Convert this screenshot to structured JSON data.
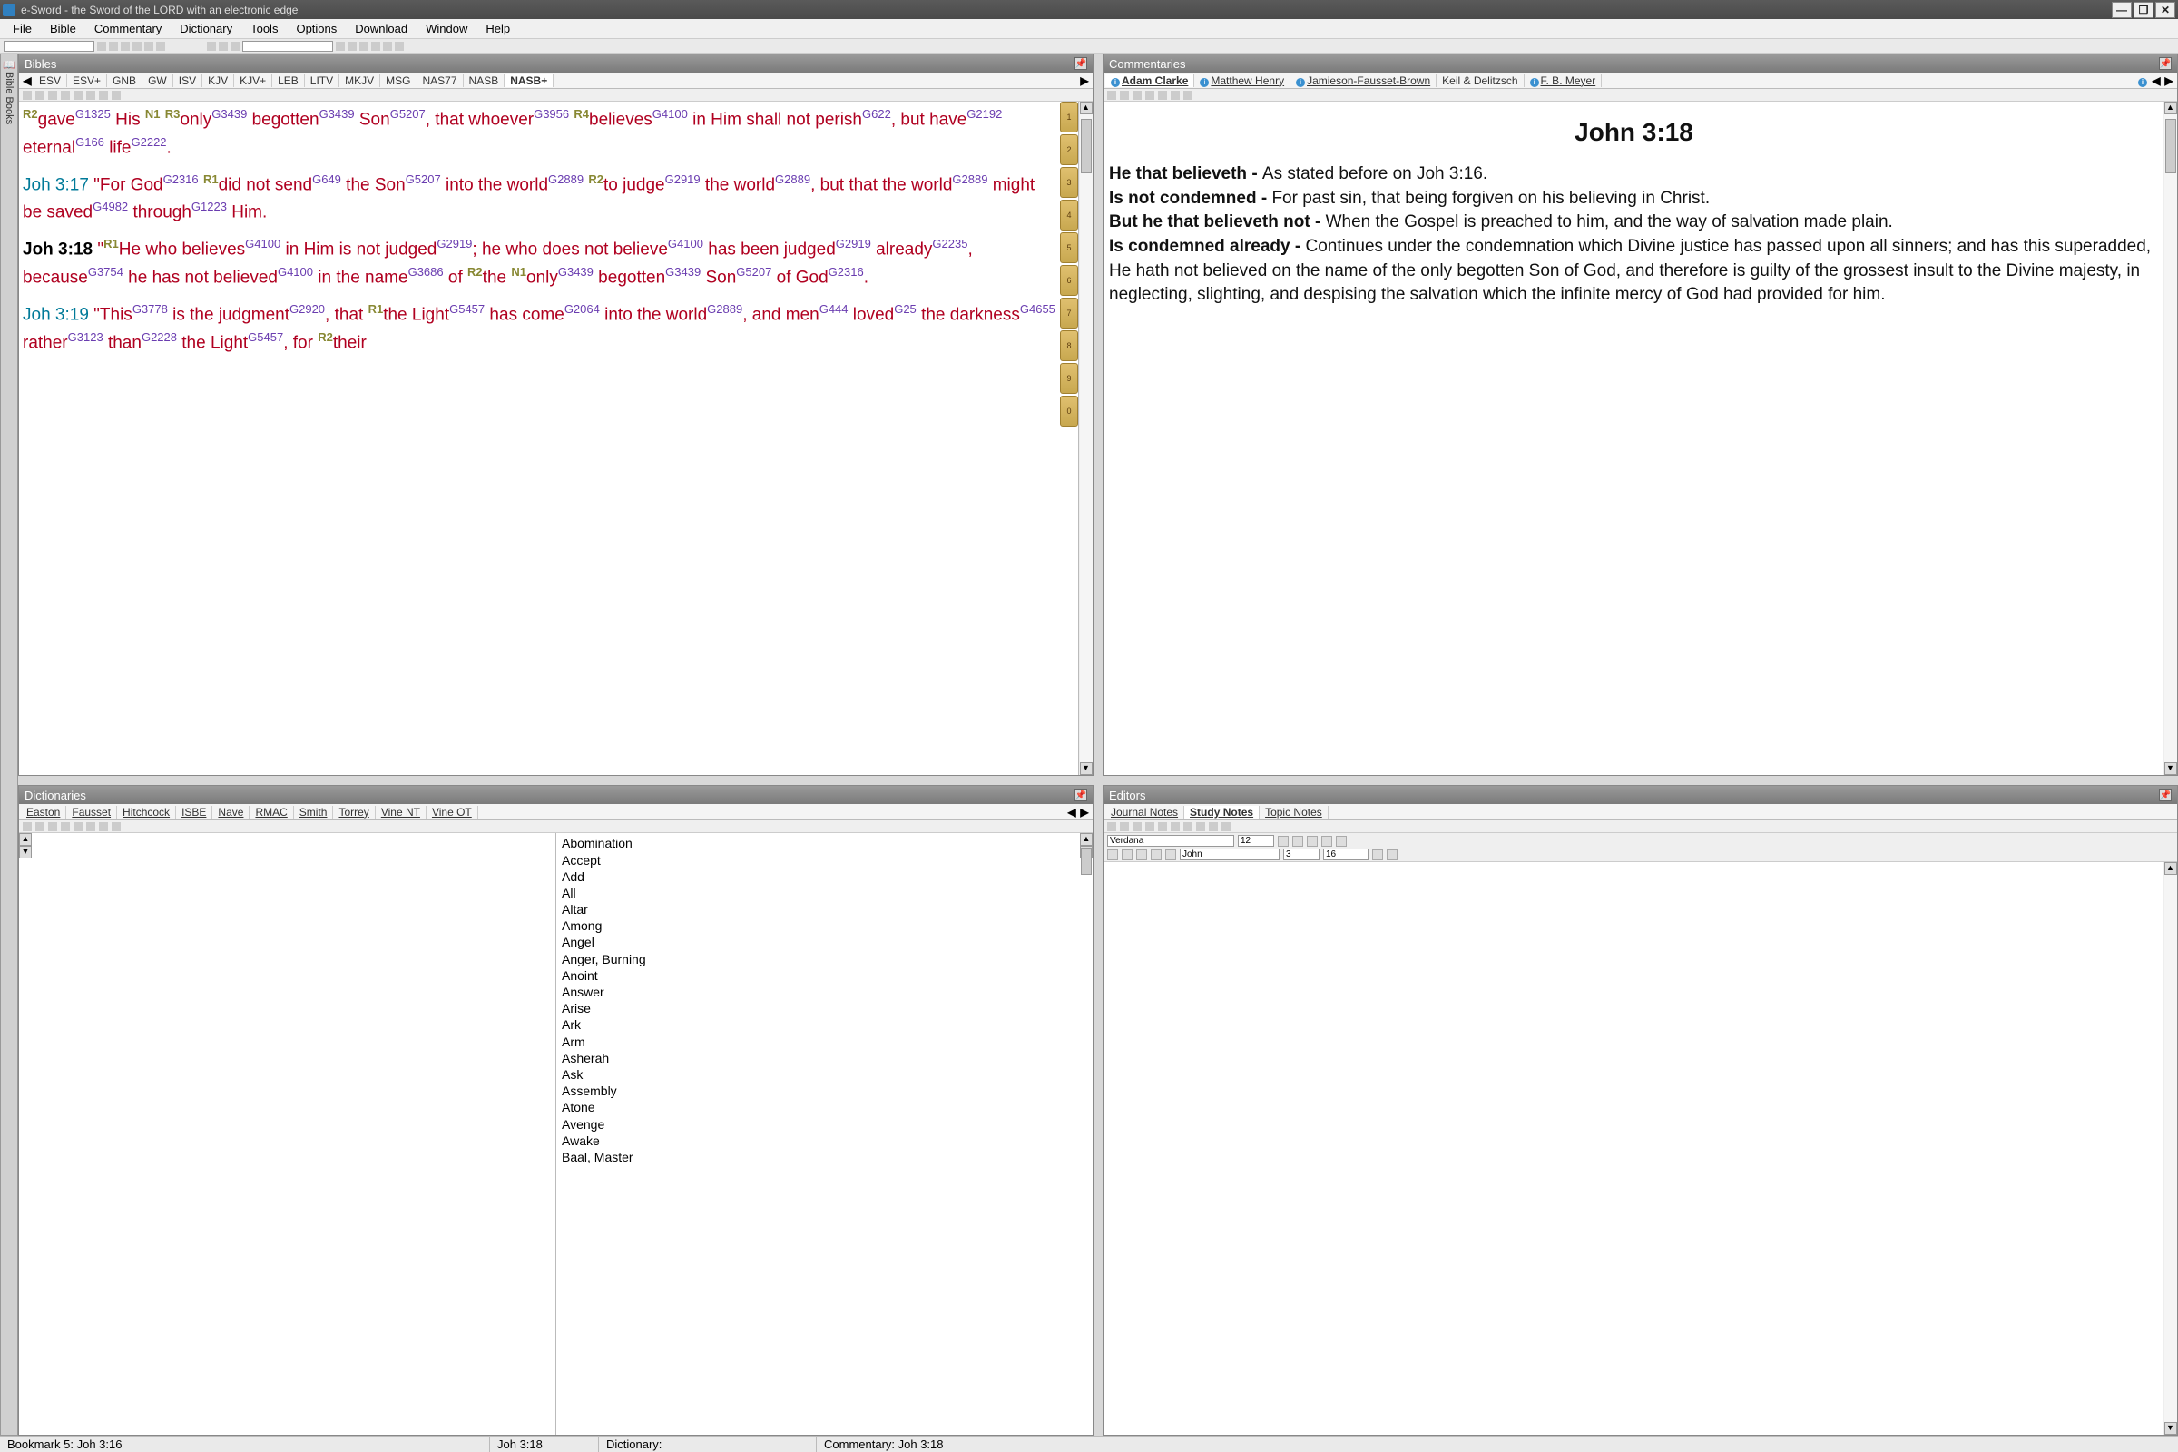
{
  "titlebar": {
    "text": "e-Sword - the Sword of the LORD with an electronic edge"
  },
  "menubar": [
    "File",
    "Bible",
    "Commentary",
    "Dictionary",
    "Tools",
    "Options",
    "Download",
    "Window",
    "Help"
  ],
  "panes": {
    "bibles": {
      "title": "Bibles",
      "tabs": [
        "ESV",
        "ESV+",
        "GNB",
        "GW",
        "ISV",
        "KJV",
        "KJV+",
        "LEB",
        "LITV",
        "MKJV",
        "MSG",
        "NAS77",
        "NASB",
        "NASB+"
      ],
      "verses": [
        {
          "ref": "",
          "segments": [
            {
              "t": "note",
              "v": "R2"
            },
            {
              "t": "w",
              "v": "gave"
            },
            {
              "t": "s",
              "v": "G1325"
            },
            {
              "t": "w",
              "v": " His "
            },
            {
              "t": "note",
              "v": "N1"
            },
            {
              "t": "w",
              "v": " "
            },
            {
              "t": "note",
              "v": "R3"
            },
            {
              "t": "w",
              "v": "only"
            },
            {
              "t": "s",
              "v": "G3439"
            },
            {
              "t": "w",
              "v": " begotten"
            },
            {
              "t": "s",
              "v": "G3439"
            },
            {
              "t": "w",
              "v": " Son"
            },
            {
              "t": "s",
              "v": "G5207"
            },
            {
              "t": "w",
              "v": ", that whoever"
            },
            {
              "t": "s",
              "v": "G3956"
            },
            {
              "t": "w",
              "v": " "
            },
            {
              "t": "note",
              "v": "R4"
            },
            {
              "t": "w",
              "v": "believes"
            },
            {
              "t": "s",
              "v": "G4100"
            },
            {
              "t": "w",
              "v": " in Him shall not perish"
            },
            {
              "t": "s",
              "v": "G622"
            },
            {
              "t": "w",
              "v": ", but have"
            },
            {
              "t": "s",
              "v": "G2192"
            },
            {
              "t": "w",
              "v": " eternal"
            },
            {
              "t": "s",
              "v": "G166"
            },
            {
              "t": "w",
              "v": " life"
            },
            {
              "t": "s",
              "v": "G2222"
            },
            {
              "t": "w",
              "v": "."
            }
          ]
        },
        {
          "ref": "Joh 3:17",
          "segments": [
            {
              "t": "w",
              "v": "\"For God"
            },
            {
              "t": "s",
              "v": "G2316"
            },
            {
              "t": "w",
              "v": " "
            },
            {
              "t": "note",
              "v": "R1"
            },
            {
              "t": "w",
              "v": "did not send"
            },
            {
              "t": "s",
              "v": "G649"
            },
            {
              "t": "w",
              "v": " the Son"
            },
            {
              "t": "s",
              "v": "G5207"
            },
            {
              "t": "w",
              "v": " into the world"
            },
            {
              "t": "s",
              "v": "G2889"
            },
            {
              "t": "w",
              "v": " "
            },
            {
              "t": "note",
              "v": "R2"
            },
            {
              "t": "w",
              "v": "to judge"
            },
            {
              "t": "s",
              "v": "G2919"
            },
            {
              "t": "w",
              "v": " the world"
            },
            {
              "t": "s",
              "v": "G2889"
            },
            {
              "t": "w",
              "v": ", but that the world"
            },
            {
              "t": "s",
              "v": "G2889"
            },
            {
              "t": "w",
              "v": " might be saved"
            },
            {
              "t": "s",
              "v": "G4982"
            },
            {
              "t": "w",
              "v": " through"
            },
            {
              "t": "s",
              "v": "G1223"
            },
            {
              "t": "w",
              "v": " Him."
            }
          ]
        },
        {
          "ref": "Joh 3:18",
          "bold": true,
          "segments": [
            {
              "t": "w",
              "v": "\""
            },
            {
              "t": "note",
              "v": "R1"
            },
            {
              "t": "w",
              "v": "He who believes"
            },
            {
              "t": "s",
              "v": "G4100"
            },
            {
              "t": "w",
              "v": " in Him is not judged"
            },
            {
              "t": "s",
              "v": "G2919"
            },
            {
              "t": "w",
              "v": "; he who does not believe"
            },
            {
              "t": "s",
              "v": "G4100"
            },
            {
              "t": "w",
              "v": " has been judged"
            },
            {
              "t": "s",
              "v": "G2919"
            },
            {
              "t": "w",
              "v": " already"
            },
            {
              "t": "s",
              "v": "G2235"
            },
            {
              "t": "w",
              "v": ", because"
            },
            {
              "t": "s",
              "v": "G3754"
            },
            {
              "t": "w",
              "v": " he has not believed"
            },
            {
              "t": "s",
              "v": "G4100"
            },
            {
              "t": "w",
              "v": " in the name"
            },
            {
              "t": "s",
              "v": "G3686"
            },
            {
              "t": "w",
              "v": " of "
            },
            {
              "t": "note",
              "v": "R2"
            },
            {
              "t": "w",
              "v": "the "
            },
            {
              "t": "note",
              "v": "N1"
            },
            {
              "t": "w",
              "v": "only"
            },
            {
              "t": "s",
              "v": "G3439"
            },
            {
              "t": "w",
              "v": " begotten"
            },
            {
              "t": "s",
              "v": "G3439"
            },
            {
              "t": "w",
              "v": " Son"
            },
            {
              "t": "s",
              "v": "G5207"
            },
            {
              "t": "w",
              "v": " of God"
            },
            {
              "t": "s",
              "v": "G2316"
            },
            {
              "t": "w",
              "v": "."
            }
          ]
        },
        {
          "ref": "Joh 3:19",
          "segments": [
            {
              "t": "w",
              "v": "\"This"
            },
            {
              "t": "s",
              "v": "G3778"
            },
            {
              "t": "w",
              "v": " is the judgment"
            },
            {
              "t": "s",
              "v": "G2920"
            },
            {
              "t": "w",
              "v": ", that "
            },
            {
              "t": "note",
              "v": "R1"
            },
            {
              "t": "w",
              "v": "the Light"
            },
            {
              "t": "s",
              "v": "G5457"
            },
            {
              "t": "w",
              "v": " has come"
            },
            {
              "t": "s",
              "v": "G2064"
            },
            {
              "t": "w",
              "v": " into the world"
            },
            {
              "t": "s",
              "v": "G2889"
            },
            {
              "t": "w",
              "v": ", and men"
            },
            {
              "t": "s",
              "v": "G444"
            },
            {
              "t": "w",
              "v": " loved"
            },
            {
              "t": "s",
              "v": "G25"
            },
            {
              "t": "w",
              "v": " the darkness"
            },
            {
              "t": "s",
              "v": "G4655"
            },
            {
              "t": "w",
              "v": " rather"
            },
            {
              "t": "s",
              "v": "G3123"
            },
            {
              "t": "w",
              "v": " than"
            },
            {
              "t": "s",
              "v": "G2228"
            },
            {
              "t": "w",
              "v": " the Light"
            },
            {
              "t": "s",
              "v": "G5457"
            },
            {
              "t": "w",
              "v": ", for "
            },
            {
              "t": "note",
              "v": "R2"
            },
            {
              "t": "w",
              "v": "their"
            }
          ]
        }
      ]
    },
    "commentaries": {
      "title": "Commentaries",
      "tabs": [
        {
          "label": "Adam Clarke",
          "info": true,
          "underlined": true
        },
        {
          "label": "Matthew Henry",
          "info": true,
          "underlined": true
        },
        {
          "label": "Jamieson-Fausset-Brown",
          "info": true,
          "underlined": true
        },
        {
          "label": "Keil & Delitzsch",
          "info": false,
          "underlined": false
        },
        {
          "label": "F. B. Meyer",
          "info": true,
          "underlined": true
        }
      ],
      "heading": "John 3:18",
      "paragraphs": [
        {
          "b": "He that believeth - ",
          "t": "As stated before on Joh 3:16."
        },
        {
          "b": "Is not condemned - ",
          "t": "For past sin, that being forgiven on his believing in Christ."
        },
        {
          "b": "But he that believeth not - ",
          "t": "When the Gospel is preached to him, and the way of salvation made plain."
        },
        {
          "b": "Is condemned already - ",
          "t": "Continues under the condemnation which Divine justice has passed upon all sinners; and has this superadded, He hath not believed on the name of the only begotten Son of God, and therefore is guilty of the grossest insult to the Divine majesty, in neglecting, slighting, and despising the salvation which the infinite mercy of God had provided for him."
        }
      ]
    },
    "dictionaries": {
      "title": "Dictionaries",
      "tabs": [
        "Easton",
        "Fausset",
        "Hitchcock",
        "ISBE",
        "Nave",
        "RMAC",
        "Smith",
        "Torrey",
        "Vine NT",
        "Vine OT"
      ],
      "entries": [
        "Abomination",
        "Accept",
        "Add",
        "All",
        "Altar",
        "Among",
        "Angel",
        "Anger, Burning",
        "Anoint",
        "Answer",
        "Arise",
        "Ark",
        "Arm",
        "Asherah",
        "Ask",
        "Assembly",
        "Atone",
        "Avenge",
        "Awake",
        "Baal, Master"
      ]
    },
    "editors": {
      "title": "Editors",
      "tabs": [
        "Journal Notes",
        "Study Notes",
        "Topic Notes"
      ],
      "font": "Verdana",
      "size": "12",
      "book": "John",
      "chapter": "3",
      "verse": "16"
    }
  },
  "sidebar_label": "Bible Books",
  "statusbar": {
    "bookmark": "Bookmark 5: Joh 3:16",
    "ref": "Joh 3:18",
    "dict": "Dictionary:",
    "comm": "Commentary: Joh 3:18"
  }
}
